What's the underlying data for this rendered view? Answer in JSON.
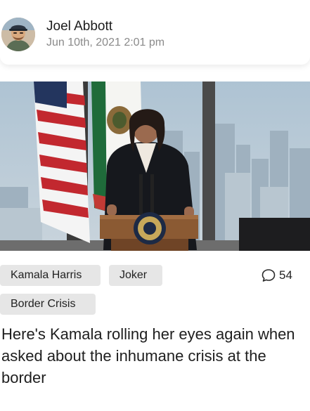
{
  "post": {
    "author": {
      "name": "Joel Abbott",
      "avatar_icon": "user-avatar"
    },
    "date": "Jun 10th, 2021 2:01 pm",
    "image": {
      "subject": "speaker at podium with flags",
      "alt": ""
    },
    "tags": [
      "Kamala Harris",
      "Joker",
      "Border Crisis"
    ],
    "comments": {
      "count": "54",
      "icon": "comment-bubble-icon"
    },
    "caption": "Here's Kamala rolling her eyes again when asked about the inhumane crisis at the border"
  }
}
